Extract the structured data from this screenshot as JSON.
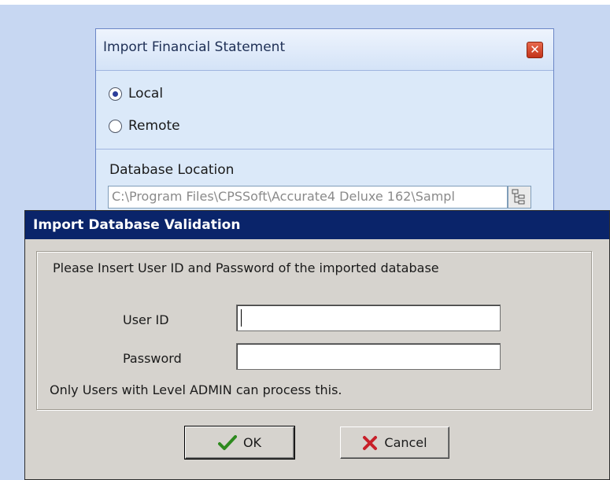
{
  "background_window": {
    "title": "Import Financial Statement",
    "options": [
      {
        "label": "Local",
        "checked": true
      },
      {
        "label": "Remote",
        "checked": false
      }
    ],
    "db_location_label": "Database Location",
    "db_path": "C:\\Program Files\\CPSSoft\\Accurate4 Deluxe 162\\Sampl"
  },
  "dialog": {
    "title": "Import Database Validation",
    "instruction": "Please Insert User ID and Password of the imported database",
    "user_id_label": "User ID",
    "user_id_value": "",
    "password_label": "Password",
    "password_value": "",
    "note": "Only Users with Level ADMIN can process this.",
    "ok_label": "OK",
    "cancel_label": "Cancel"
  },
  "icons": {
    "close": "close-icon",
    "browse": "folder-tree-icon",
    "ok": "checkmark-icon",
    "cancel": "x-icon"
  },
  "colors": {
    "title_bar": "#0a246a",
    "dialog_bg": "#d6d3ce",
    "backdrop": "#c7d7f2"
  }
}
